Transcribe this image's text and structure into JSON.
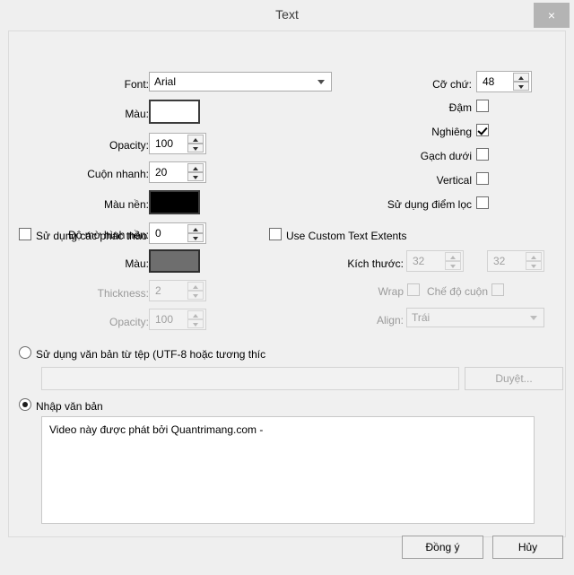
{
  "window": {
    "title": "Text",
    "close_label": "×"
  },
  "left_column": {
    "font": {
      "label": "Font:",
      "value": "Arial"
    },
    "color": {
      "label": "Màu:",
      "value": "#ffffff"
    },
    "opacity": {
      "label": "Opacity:",
      "value": "100"
    },
    "scroll_speed": {
      "label": "Cuộn nhanh:",
      "value": "20"
    },
    "bg_color": {
      "label": "Màu nền:",
      "value": "#000000"
    },
    "bg_opacity": {
      "label": "Độ mờ hình nền:",
      "value": "0"
    }
  },
  "right_column": {
    "font_size": {
      "label": "Cỡ chứ:",
      "value": "48"
    },
    "bold": {
      "label": "Đậm",
      "checked": false
    },
    "italic": {
      "label": "Nghiêng",
      "checked": true
    },
    "underline": {
      "label": "Gạch dưới",
      "checked": false
    },
    "vertical": {
      "label": "Vertical",
      "checked": false
    },
    "use_filter_point": {
      "label": "Sử dụng điểm lọc",
      "checked": false
    }
  },
  "outline_group": {
    "enable": {
      "label": "Sử dụng các phác thảo",
      "checked": false
    },
    "color": {
      "label": "Màu:",
      "value": "#6e6e6e"
    },
    "thickness": {
      "label": "Thickness:",
      "value": "2"
    },
    "opacity": {
      "label": "Opacity:",
      "value": "100"
    }
  },
  "extents_group": {
    "enable": {
      "label": "Use Custom Text Extents",
      "checked": false
    },
    "size": {
      "label": "Kích thước:",
      "width": "32",
      "height": "32"
    },
    "wrap": {
      "label": "Wrap",
      "checked": false
    },
    "scroll_mode": {
      "label": "Chế độ cuộn",
      "checked": false
    },
    "align": {
      "label": "Align:",
      "value": "Trái"
    }
  },
  "source_group": {
    "from_file": {
      "label": "Sử dụng văn bản từ tệp (UTF-8 hoặc tương thíc",
      "selected": false
    },
    "file_path": {
      "value": "",
      "placeholder": ""
    },
    "browse_button": {
      "label": "Duyệt..."
    },
    "enter_text": {
      "label": "Nhập văn bản",
      "selected": true
    },
    "text_value": "Video này được phát bởi Quantrimang.com -"
  },
  "footer": {
    "ok_label": "Đồng ý",
    "cancel_label": "Hủy"
  }
}
